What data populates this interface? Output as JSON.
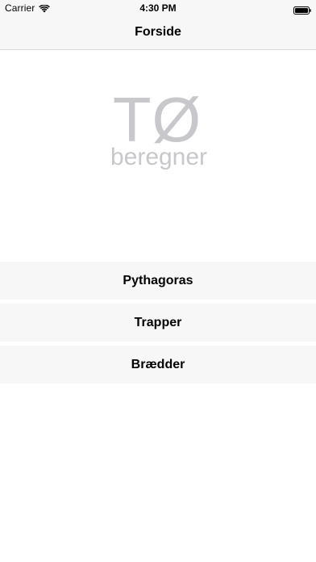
{
  "status_bar": {
    "carrier": "Carrier",
    "time": "4:30 PM"
  },
  "nav": {
    "title": "Forside"
  },
  "logo": {
    "main": "TØ",
    "sub": "beregner"
  },
  "menu": {
    "items": [
      {
        "label": "Pythagoras"
      },
      {
        "label": "Trapper"
      },
      {
        "label": "Brædder"
      }
    ]
  },
  "colors": {
    "bar_background": "#f7f7f7",
    "logo_gray": "#c8c8cc"
  }
}
